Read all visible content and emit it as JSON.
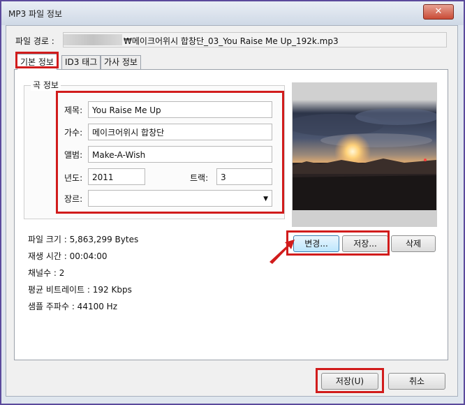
{
  "window": {
    "title": "MP3 파일 정보",
    "close_label": "✕"
  },
  "path": {
    "label": "파일 경로 :",
    "value": "₩메이크어위시 합창단_03_You Raise Me Up_192k.mp3"
  },
  "tabs": [
    {
      "label": "기본 정보",
      "active": true
    },
    {
      "label": "ID3 태그",
      "active": false
    },
    {
      "label": "가사 정보",
      "active": false
    }
  ],
  "song_info": {
    "caption": "곡 정보",
    "title_label": "제목:",
    "title_value": "You Raise Me Up",
    "artist_label": "가수:",
    "artist_value": "메이크어위시 합창단",
    "album_label": "앨범:",
    "album_value": "Make-A-Wish",
    "year_label": "년도:",
    "year_value": "2011",
    "track_label": "트랙:",
    "track_value": "3",
    "genre_label": "장르:",
    "genre_value": ""
  },
  "art_buttons": {
    "change": "변경...",
    "save": "저장...",
    "delete": "삭제"
  },
  "file_info": {
    "size": "파일 크기 : 5,863,299 Bytes",
    "duration": "재생 시간 : 00:04:00",
    "channels": "채널수 : 2",
    "bitrate": "평균 비트레이트 : 192 Kbps",
    "sample_rate": "샘플 주파수 : 44100 Hz"
  },
  "footer": {
    "save": "저장(U)",
    "cancel": "취소"
  },
  "colors": {
    "highlight": "#d11c1c",
    "window_border": "#5b4a9c"
  }
}
